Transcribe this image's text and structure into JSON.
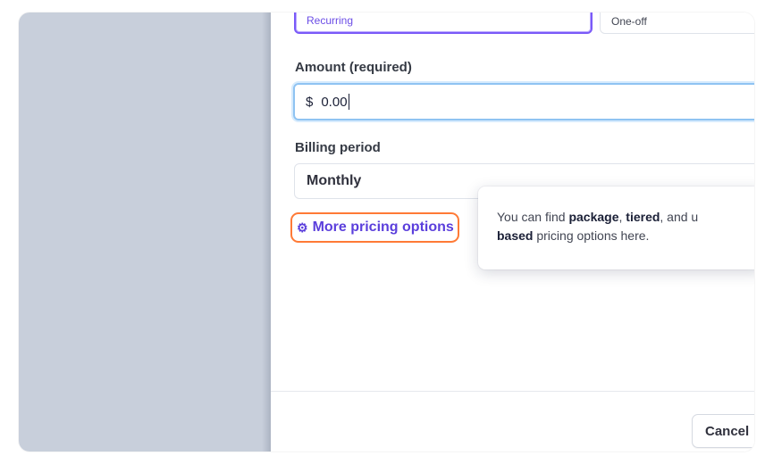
{
  "price_type": {
    "recurring_label": "Recurring",
    "oneoff_label": "One-off",
    "selected": "Recurring"
  },
  "amount": {
    "label": "Amount (required)",
    "currency": "$",
    "value": "0.00"
  },
  "billing_period": {
    "label": "Billing period",
    "value": "Monthly"
  },
  "more_pricing": {
    "icon": "gear-icon",
    "label": "More pricing options"
  },
  "tooltip": {
    "text_1": "You can find ",
    "bold_1": "package",
    "text_2": ", ",
    "bold_2": "tiered",
    "text_3": ", and u",
    "bold_3": "based",
    "text_4": " pricing options here."
  },
  "footer": {
    "cancel_label": "Cancel"
  },
  "colors": {
    "accent": "#6b4de6",
    "highlight": "#ff7a36",
    "focus_ring": "#8fc3f2",
    "backdrop": "#c8cfdb"
  }
}
